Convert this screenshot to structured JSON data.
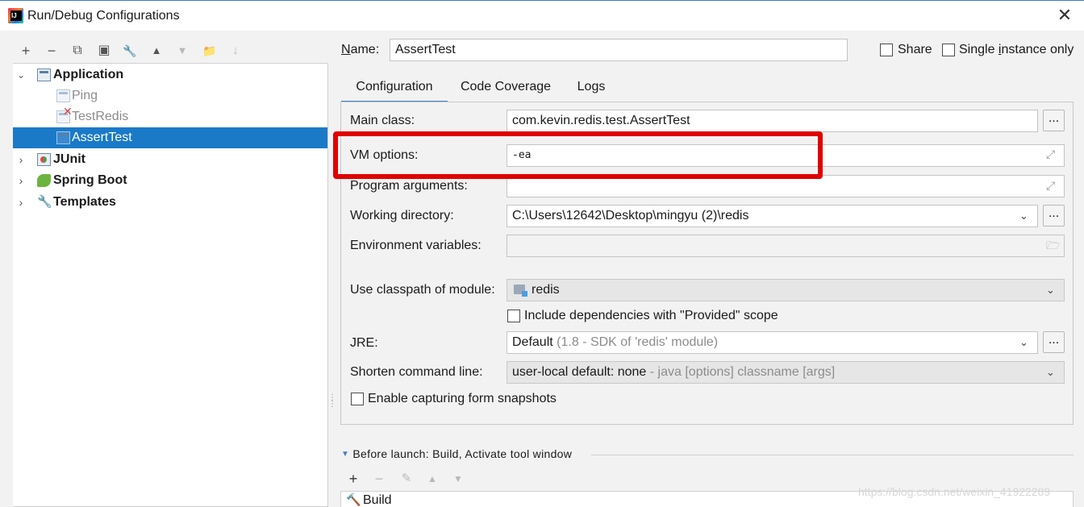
{
  "window": {
    "title": "Run/Debug Configurations",
    "close_glyph": "✕"
  },
  "toolbar": [
    {
      "name": "add-button",
      "glyph": "+",
      "disabled": false
    },
    {
      "name": "remove-button",
      "glyph": "−",
      "disabled": false
    },
    {
      "name": "copy-button",
      "glyph": "⧉",
      "disabled": false
    },
    {
      "name": "save-button",
      "glyph": "▣",
      "disabled": false
    },
    {
      "name": "edit-defaults-button",
      "glyph": "🔧",
      "disabled": false
    },
    {
      "name": "move-up-button",
      "glyph": "▲",
      "disabled": false
    },
    {
      "name": "move-down-button",
      "glyph": "▼",
      "disabled": true
    },
    {
      "name": "new-folder-button",
      "glyph": "📁",
      "disabled": false
    },
    {
      "name": "sort-button",
      "glyph": "↓",
      "disabled": true
    }
  ],
  "tree": {
    "application": {
      "label": "Application",
      "expanded": true
    },
    "children": [
      {
        "label": "Ping",
        "faded": true
      },
      {
        "label": "TestRedis",
        "faded": true,
        "error": true
      },
      {
        "label": "AssertTest",
        "selected": true
      }
    ],
    "groups": [
      {
        "label": "JUnit"
      },
      {
        "label": "Spring Boot"
      },
      {
        "label": "Templates"
      }
    ]
  },
  "header": {
    "name_label_accel": "N",
    "name_label_rest": "ame:",
    "name_value": "AssertTest",
    "share_label": "Share",
    "single_instance_label_a": "Single ",
    "single_instance_label_accel": "i",
    "single_instance_label_b": "nstance only"
  },
  "tabs": [
    "Configuration",
    "Code Coverage",
    "Logs"
  ],
  "form": {
    "main_class_label": "Main class:",
    "main_class_value": "com.kevin.redis.test.AssertTest",
    "vm_options_label": "VM options:",
    "vm_options_value": "-ea",
    "program_arguments_label": "Program arguments:",
    "program_arguments_value": "",
    "working_directory_label": "Working directory:",
    "working_directory_value": "C:\\Users\\12642\\Desktop\\mingyu (2)\\redis",
    "env_variables_label": "Environment variables:",
    "env_variables_value": "",
    "classpath_module_label": "Use classpath of module:",
    "classpath_module_value": "redis",
    "include_provided_label": "Include dependencies with \"Provided\" scope",
    "jre_label": "JRE:",
    "jre_value": "Default",
    "jre_hint": " (1.8 - SDK of 'redis' module)",
    "shorten_label": "Shorten command line:",
    "shorten_value": "user-local default: none",
    "shorten_hint": " - java [options] classname [args]",
    "enable_capturing_label": "Enable capturing form snapshots",
    "browse_glyph": "...",
    "dropdown_glyph": "⌄",
    "expand_glyph": "⤢"
  },
  "before_launch": {
    "title": "Before launch: Build, Activate tool window",
    "items": [
      "Build"
    ]
  },
  "watermark": "https://blog.csdn.net/weixin_41922289",
  "colors": {
    "selection": "#1a7ac8",
    "highlight_box": "#e00000",
    "tab_underline": "#4083c9"
  }
}
